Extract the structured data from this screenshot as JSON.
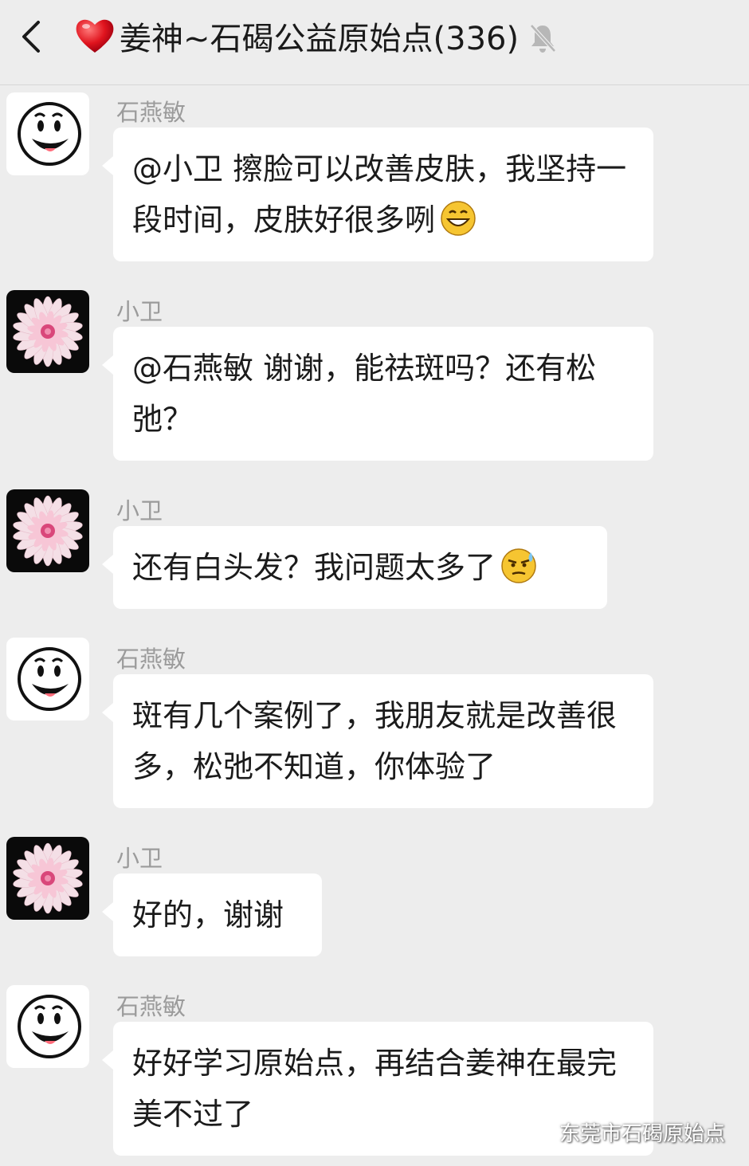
{
  "header": {
    "title": "姜神~石碣公益原始点(336)",
    "icons": [
      "back-chevron-icon",
      "heart-icon",
      "mute-bell-icon"
    ]
  },
  "colors": {
    "background": "#ededed",
    "bubble": "#ffffff",
    "sender_name": "#9b9b9b"
  },
  "messages": [
    {
      "sender": "石燕敏",
      "avatar": "smiley-face",
      "text": "@小卫  擦脸可以改善皮肤，我坚持一段时间，皮肤好很多咧",
      "emoji": "grin-emoji"
    },
    {
      "sender": "小卫",
      "avatar": "pink-flower",
      "text": "@石燕敏  谢谢，能祛斑吗？还有松弛？"
    },
    {
      "sender": "小卫",
      "avatar": "pink-flower",
      "text": "还有白头发？我问题太多了",
      "emoji": "sweat-emoji"
    },
    {
      "sender": "石燕敏",
      "avatar": "smiley-face",
      "text": "斑有几个案例了，我朋友就是改善很多，松弛不知道，你体验了"
    },
    {
      "sender": "小卫",
      "avatar": "pink-flower",
      "text": "好的，谢谢"
    },
    {
      "sender": "石燕敏",
      "avatar": "smiley-face",
      "text": "好好学习原始点，再结合姜神在最完美不过了"
    }
  ],
  "watermark": {
    "text": "东莞市石碣原始点",
    "icon": "wechat-icon"
  }
}
